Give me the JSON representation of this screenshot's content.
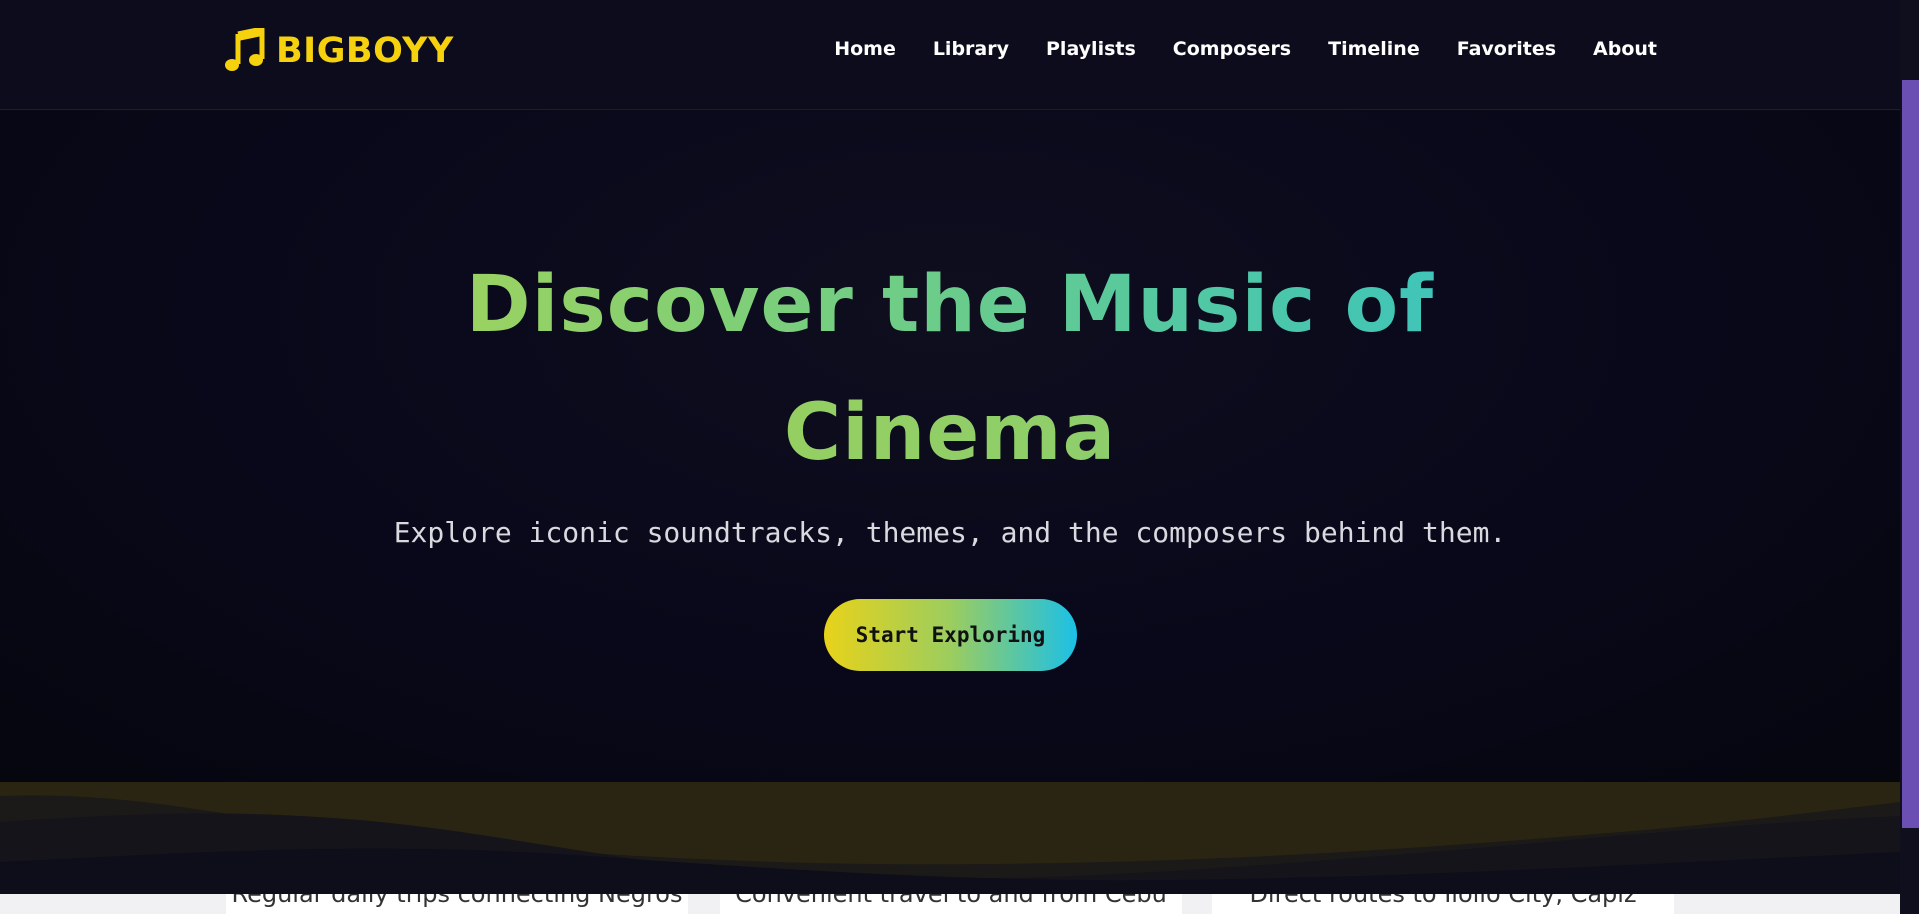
{
  "brand": {
    "name": "BIGBOYY",
    "icon": "music-note-icon",
    "color": "#f6d10e"
  },
  "nav": {
    "items": [
      {
        "label": "Home"
      },
      {
        "label": "Library"
      },
      {
        "label": "Playlists"
      },
      {
        "label": "Composers"
      },
      {
        "label": "Timeline"
      },
      {
        "label": "Favorites"
      },
      {
        "label": "About"
      }
    ]
  },
  "hero": {
    "title_line1": "Discover the Music of",
    "title_line2": "Cinema",
    "subtitle": "Explore iconic soundtracks, themes, and the composers behind them.",
    "cta_label": "Start Exploring"
  },
  "bottom_cards": [
    {
      "text": "Regular daily trips connecting Negros"
    },
    {
      "text": "Convenient travel to and from Cebu"
    },
    {
      "text": "Direct routes to Iloilo City, Capiz"
    }
  ],
  "colors": {
    "accent_yellow": "#f6d10e",
    "gradient_start": "#c8d63a",
    "gradient_end": "#1fc0e0",
    "scroll_thumb": "#6b4fb3"
  }
}
